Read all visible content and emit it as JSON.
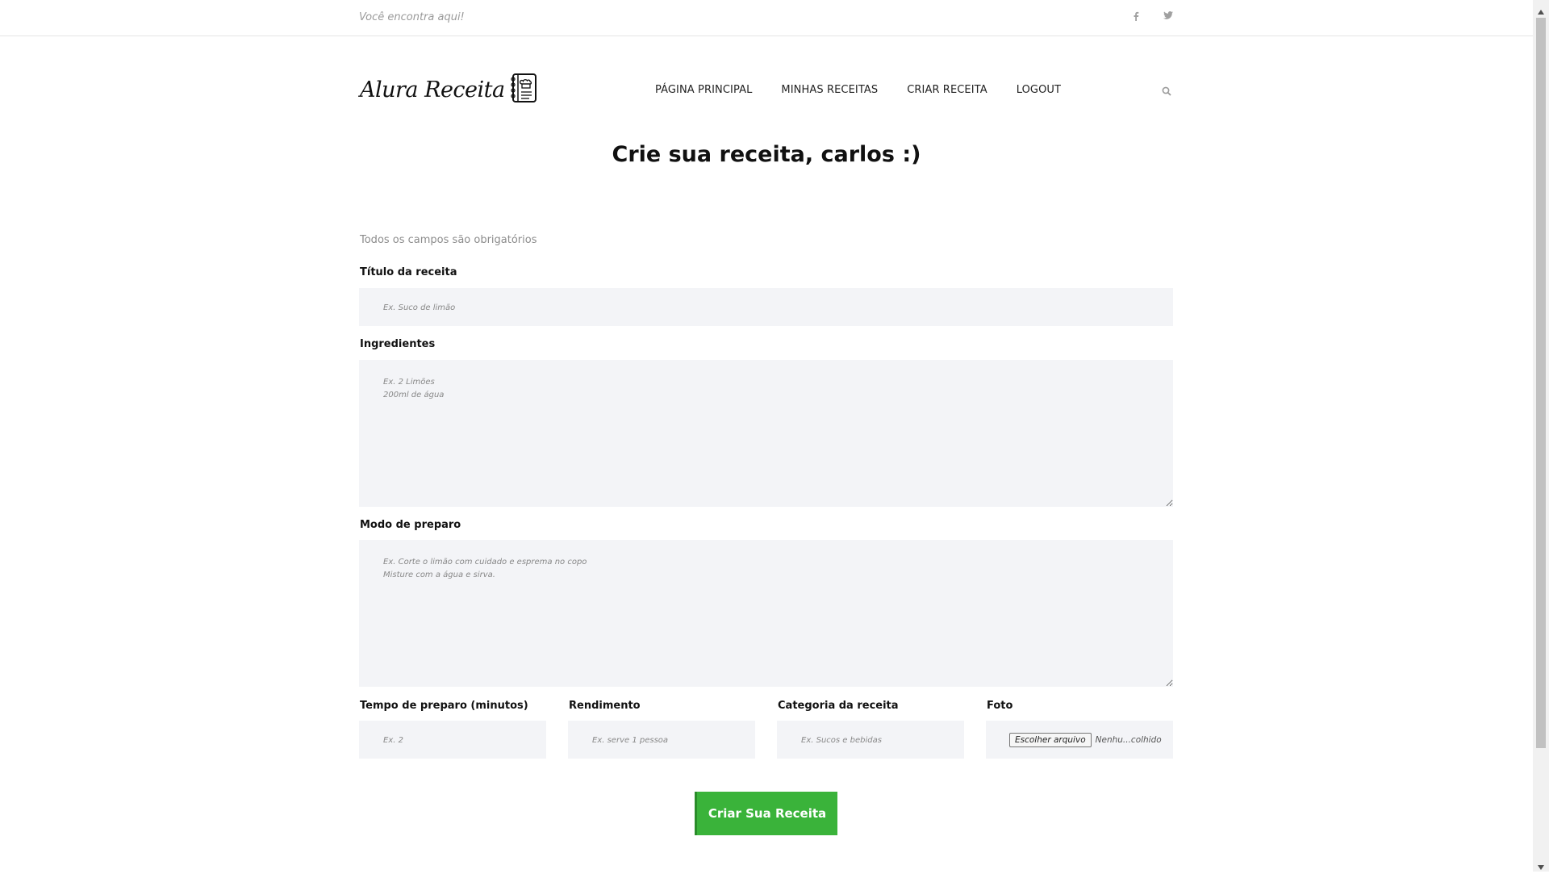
{
  "header": {
    "tagline": "Você encontra aqui!",
    "social": [
      {
        "icon": "facebook-icon"
      },
      {
        "icon": "twitter-icon"
      }
    ]
  },
  "logo": {
    "text": "Alura Receita",
    "icon": "recipe-book-icon"
  },
  "nav": {
    "items": [
      {
        "label": "PÁGINA PRINCIPAL"
      },
      {
        "label": "MINHAS RECEITAS"
      },
      {
        "label": "CRIAR RECEITA"
      },
      {
        "label": "LOGOUT"
      }
    ],
    "search_icon": "search-icon"
  },
  "page": {
    "title": "Crie sua receita, carlos :)",
    "hint": "Todos os campos são obrigatórios"
  },
  "form": {
    "title": {
      "label": "Título da receita",
      "placeholder": "Ex. Suco de limão",
      "value": ""
    },
    "ingredients": {
      "label": "Ingredientes",
      "placeholder": "Ex. 2 Limões\n200ml de água",
      "value": ""
    },
    "preparation": {
      "label": "Modo de preparo",
      "placeholder": "Ex. Corte o limão com cuidado e esprema no copo\nMisture com a água e sirva.",
      "value": ""
    },
    "time": {
      "label": "Tempo de preparo (minutos)",
      "placeholder": "Ex. 2",
      "value": ""
    },
    "yield": {
      "label": "Rendimento",
      "placeholder": "Ex. serve 1 pessoa",
      "value": ""
    },
    "category": {
      "label": "Categoria da receita",
      "placeholder": "Ex. Sucos e bebidas",
      "value": ""
    },
    "photo": {
      "label": "Foto",
      "button_label": "Escolher arquivo",
      "status": "Nenhu...colhido"
    },
    "submit_label": "Criar Sua Receita"
  },
  "colors": {
    "accent": "#3ab33a",
    "field_background": "#f3f4f7"
  }
}
